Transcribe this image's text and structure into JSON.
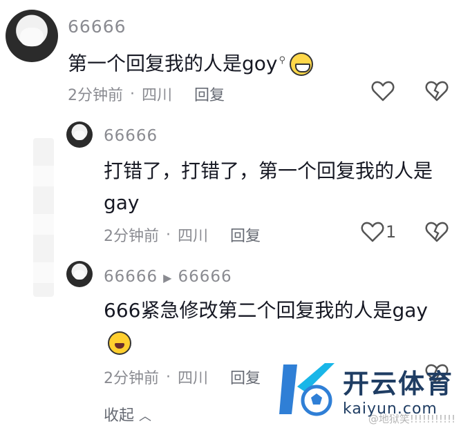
{
  "comments": [
    {
      "username": "66666",
      "text": "第一个回复我的人是goy",
      "time": "2分钟前",
      "location": "四川",
      "reply_label": "回复"
    }
  ],
  "replies": [
    {
      "username": "66666",
      "text_line1": "打错了，打错了，第一个回复我的人是",
      "text_line2": "gay",
      "time": "2分钟前",
      "location": "四川",
      "reply_label": "回复",
      "like_count": "1"
    },
    {
      "username": "66666",
      "reply_to": "66666",
      "text": "666紧急修改第二个回复我的人是gay",
      "time": "2分钟前",
      "location": "四川",
      "reply_label": "回复"
    }
  ],
  "separator": "·",
  "collapse_label": "收起",
  "watermark": {
    "brand_cn": "开云体育",
    "brand_url": "kaiyun.com",
    "weibo": "@地狱笑!!!!!!!!!!!"
  },
  "icons": {
    "like": "heart-outline-icon",
    "dislike": "broken-heart-icon",
    "arrow": "triangle-right-icon",
    "collapse": "chevron-up-icon"
  }
}
